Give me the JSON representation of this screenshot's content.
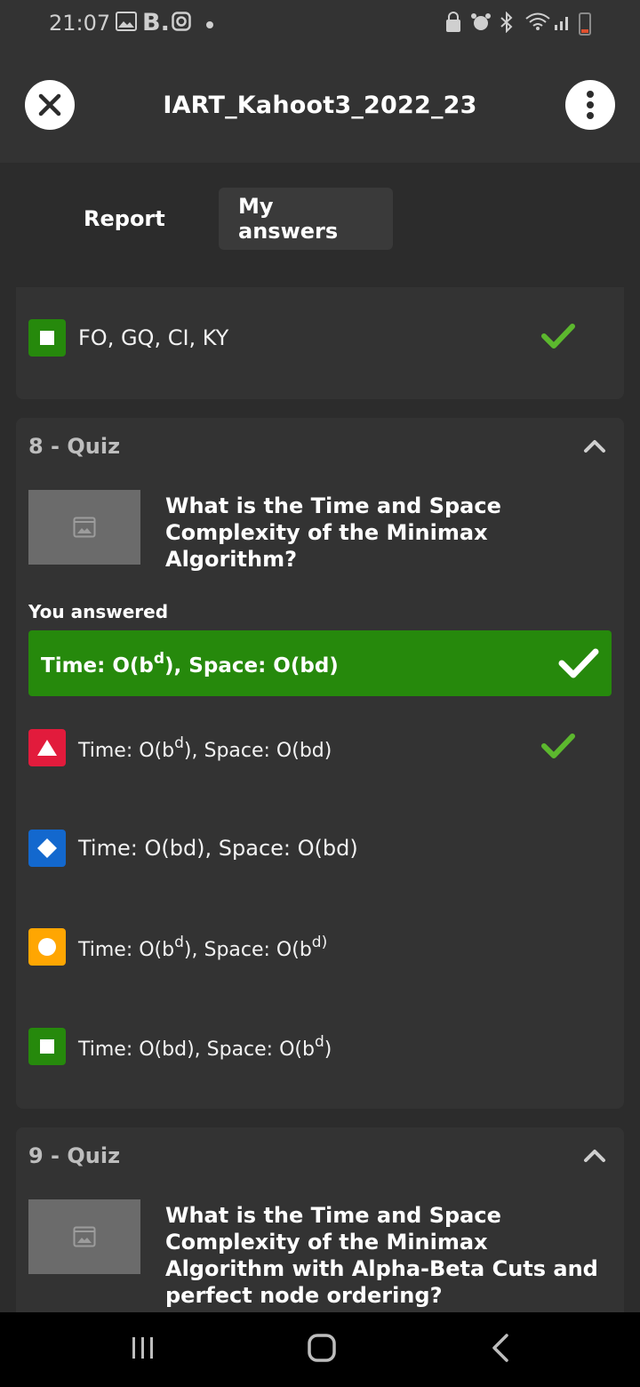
{
  "status_bar": {
    "time": "21:07",
    "icons": [
      "gallery-icon",
      "b-icon",
      "instagram-icon",
      "dot",
      "lock-icon",
      "alarm-icon",
      "bluetooth-icon",
      "wifi-icon",
      "signal-icon",
      "battery-icon"
    ]
  },
  "header": {
    "title": "IART_Kahoot3_2022_23"
  },
  "tabs": [
    {
      "label": "Report",
      "active": false
    },
    {
      "label": "My answers",
      "active": true
    }
  ],
  "prev_question": {
    "last_answer_text": "FO, GQ, CI, KY",
    "correct": true
  },
  "q8": {
    "header": "8 - Quiz",
    "question": "What is the Time and Space Complexity of the Minimax Algorithm?",
    "you_answered_label": "You answered",
    "answered": "Time: O(b^d), Space: O(bd)",
    "answers": [
      {
        "shape": "triangle",
        "text": "Time: O(b^d), Space: O(bd)",
        "correct": true
      },
      {
        "shape": "diamond",
        "text": "Time: O(bd), Space: O(bd)",
        "correct": false
      },
      {
        "shape": "circle",
        "text": "Time: O(b^d), Space: O(b^d)",
        "correct": false
      },
      {
        "shape": "square",
        "text": "Time: O(bd), Space: O(b^d)",
        "correct": false
      }
    ]
  },
  "q9": {
    "header": "9 - Quiz",
    "question": "What is the Time and Space Complexity of the Minimax Algorithm with Alpha-Beta Cuts and perfect node ordering?"
  },
  "colors": {
    "background": "#2c2c2c",
    "card": "#333333",
    "correct_green": "#26890c",
    "check_green": "#5cb82e",
    "red": "#e21b3c",
    "blue": "#1368ce",
    "yellow": "#ffa602"
  }
}
